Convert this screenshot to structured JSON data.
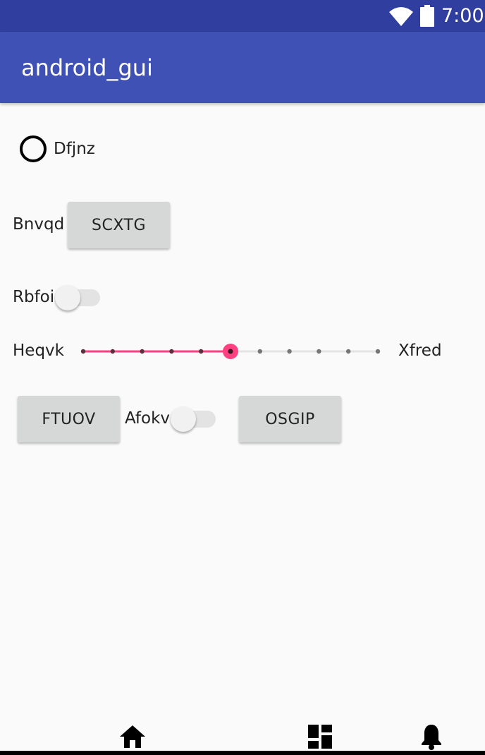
{
  "status_bar": {
    "time": "7:00"
  },
  "app_bar": {
    "title": "android_gui"
  },
  "radio": {
    "label": "Dfjnz",
    "checked": false
  },
  "row_bnvqd": {
    "label": "Bnvqd",
    "button": "SCXTG"
  },
  "row_rbfoi": {
    "label": "Rbfoi",
    "switch_on": false
  },
  "seek_row": {
    "label_left": "Heqvk",
    "label_right": "Xfred",
    "value": 5,
    "max": 10,
    "accent": "#ff4081"
  },
  "bottom_row": {
    "button_left": "FTUOV",
    "switch_label": "Afokv",
    "switch_on": false,
    "button_right": "OSGIP"
  },
  "bottom_nav": {
    "icons": [
      "home-icon",
      "dashboard-icon",
      "notifications-icon"
    ]
  },
  "colors": {
    "status_bar": "#303f9f",
    "app_bar": "#3f51b5",
    "accent": "#ff4081"
  }
}
